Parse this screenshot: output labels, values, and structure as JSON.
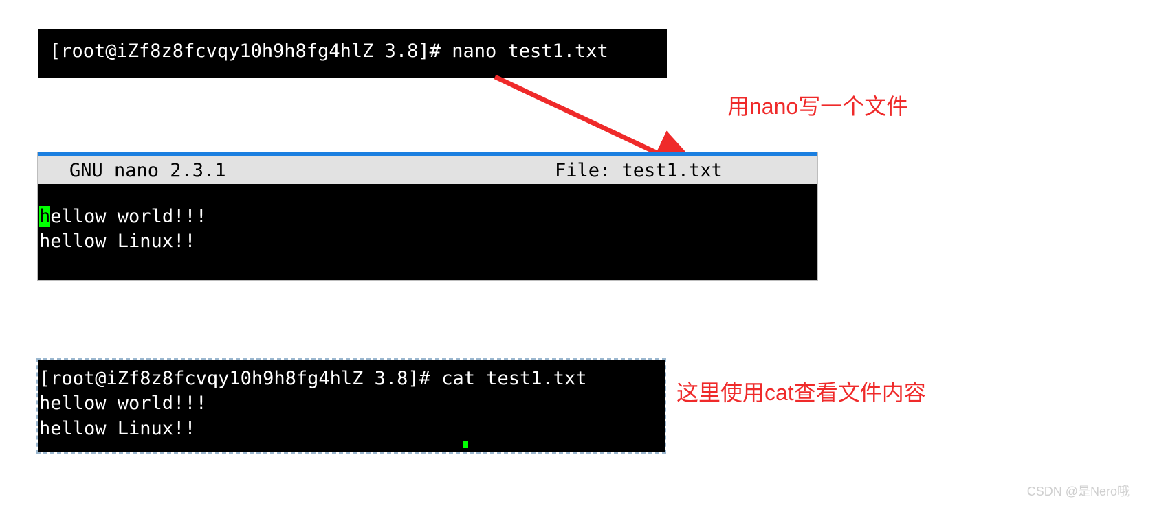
{
  "term1": {
    "prompt_cmd": "[root@iZf8z8fcvqy10h9h8fg4hlZ 3.8]# nano test1.txt"
  },
  "annot1": "用nano写一个文件",
  "nano": {
    "header_left": "GNU nano 2.3.1",
    "header_right": "File: test1.txt",
    "cursor_char": "h",
    "line1_rest": "ellow world!!!",
    "line2": "hellow Linux!!"
  },
  "term2": {
    "prompt_cmd": "[root@iZf8z8fcvqy10h9h8fg4hlZ 3.8]# cat test1.txt",
    "out1": "hellow world!!!",
    "out2": "hellow Linux!!"
  },
  "annot2": "这里使用cat查看文件内容",
  "watermark": "CSDN @是Nero哦"
}
